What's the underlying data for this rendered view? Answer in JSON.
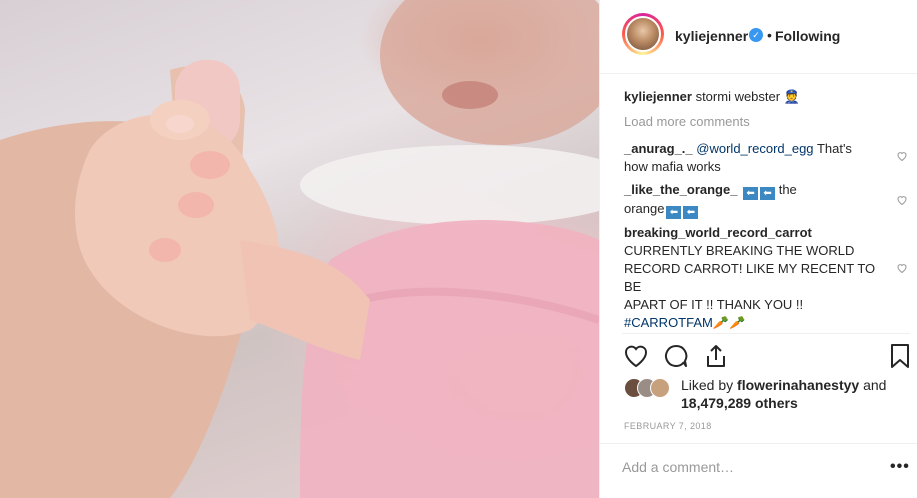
{
  "post": {
    "username": "kyliejenner",
    "separator": "•",
    "follow_status": "Following",
    "verified_icon": "verified-badge-icon"
  },
  "caption": {
    "username": "kyliejenner",
    "text": "stormi webster",
    "emoji": "👮"
  },
  "load_more": "Load more comments",
  "comments": [
    {
      "username": "_anurag_._",
      "mention": "@world_record_egg",
      "text_line1": "That's",
      "text_line2": "how mafia works"
    },
    {
      "username": "_like_the_orange_",
      "text_after": "the",
      "text_line2": "orange",
      "emoji": "⬅"
    },
    {
      "username": "breaking_world_record_carrot",
      "line1": "CURRENTLY BREAKING THE WORLD",
      "line2": "RECORD CARROT! LIKE MY RECENT TO BE",
      "line3": "APART OF IT !! THANK YOU !!",
      "hashtag": "#CARROTFAM",
      "emoji": "🥕🥕"
    }
  ],
  "actions": {
    "like_icon": "heart-icon",
    "comment_icon": "comment-icon",
    "share_icon": "share-icon",
    "save_icon": "bookmark-icon"
  },
  "likes": {
    "prefix": "Liked by",
    "user": "flowerinahanestyy",
    "and": "and",
    "count": "18,479,289 others"
  },
  "date": "FEBRUARY 7, 2018",
  "add_comment": {
    "placeholder": "Add a comment…"
  },
  "more_options": "•••",
  "colors": {
    "link": "#003569",
    "muted": "#999999",
    "verified": "#3897f0",
    "text": "#262626"
  }
}
